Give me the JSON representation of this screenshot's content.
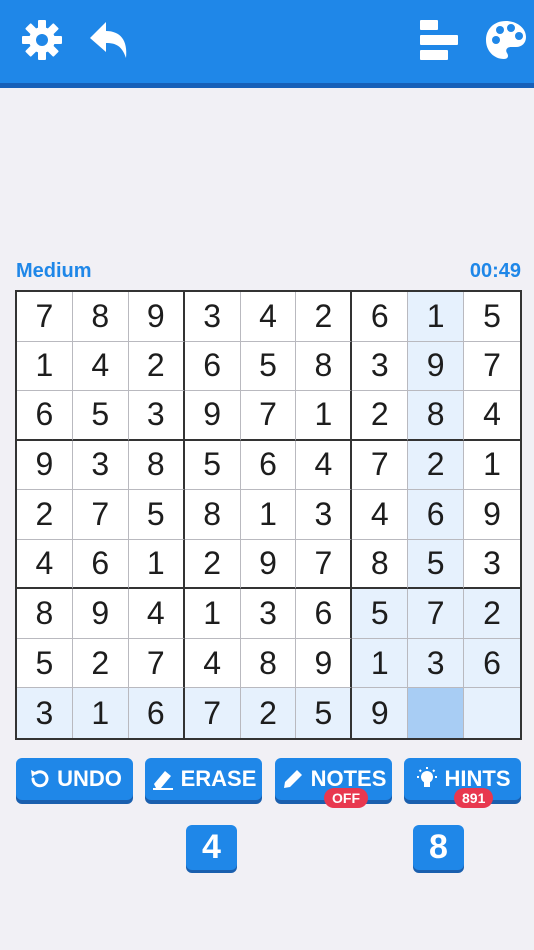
{
  "colors": {
    "accent": "#1f87e8",
    "highlight": "#e6f1fd",
    "selected": "#a8cdf4",
    "badge": "#e8384f"
  },
  "header": {
    "icons": [
      "gear-icon",
      "back-icon",
      "leaderboard-icon",
      "palette-icon"
    ]
  },
  "status": {
    "difficulty": "Medium",
    "timer": "00:49"
  },
  "grid": [
    [
      "7",
      "8",
      "9",
      "3",
      "4",
      "2",
      "6",
      "1",
      "5"
    ],
    [
      "1",
      "4",
      "2",
      "6",
      "5",
      "8",
      "3",
      "9",
      "7"
    ],
    [
      "6",
      "5",
      "3",
      "9",
      "7",
      "1",
      "2",
      "8",
      "4"
    ],
    [
      "9",
      "3",
      "8",
      "5",
      "6",
      "4",
      "7",
      "2",
      "1"
    ],
    [
      "2",
      "7",
      "5",
      "8",
      "1",
      "3",
      "4",
      "6",
      "9"
    ],
    [
      "4",
      "6",
      "1",
      "2",
      "9",
      "7",
      "8",
      "5",
      "3"
    ],
    [
      "8",
      "9",
      "4",
      "1",
      "3",
      "6",
      "5",
      "7",
      "2"
    ],
    [
      "5",
      "2",
      "7",
      "4",
      "8",
      "9",
      "1",
      "3",
      "6"
    ],
    [
      "3",
      "1",
      "6",
      "7",
      "2",
      "5",
      "9",
      "",
      ""
    ]
  ],
  "selected_cell": {
    "row": 9,
    "col": 8
  },
  "toolbar": {
    "undo_label": "UNDO",
    "erase_label": "ERASE",
    "notes_label": "NOTES",
    "notes_state": "OFF",
    "hints_label": "HINTS",
    "hints_count": "891"
  },
  "numpad": [
    "4",
    "8"
  ]
}
